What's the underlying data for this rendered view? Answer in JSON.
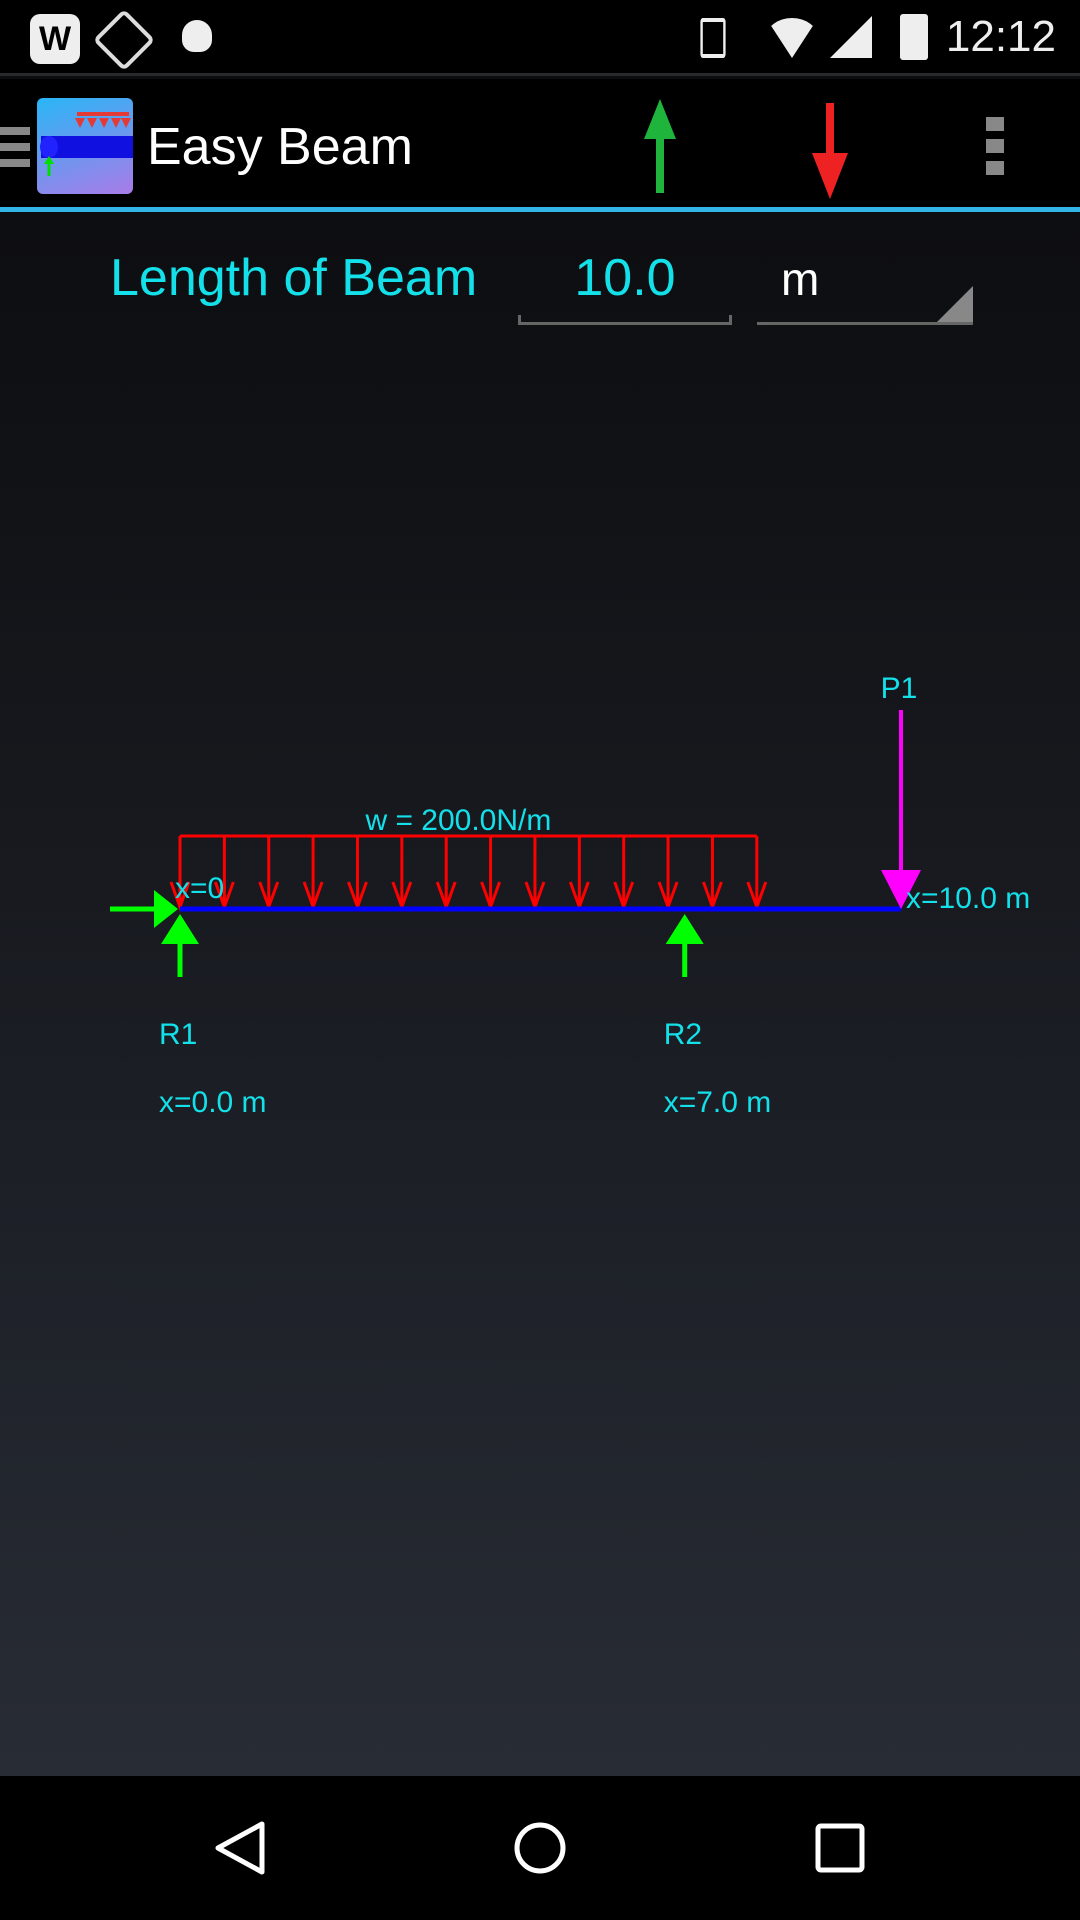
{
  "status_bar": {
    "time": "12:12",
    "left_icons": [
      "wikipedia-icon",
      "maps-navigation-icon",
      "android-debug-icon"
    ],
    "right_icons": [
      "vibrate-icon",
      "wifi-icon",
      "signal-icon",
      "battery-charging-icon"
    ]
  },
  "action_bar": {
    "title": "Easy Beam",
    "actions": [
      "add-upward-force-icon",
      "add-downward-force-icon",
      "overflow-menu-icon"
    ]
  },
  "length": {
    "label": "Length of Beam",
    "value": "10.0",
    "unit": "m"
  },
  "diagram": {
    "beam_length": 10.0,
    "colors": {
      "beam": "#0000ff",
      "distributed_load": "#ff0000",
      "point_load": "#ff00ff",
      "support": "#00ff00",
      "text": "#14e0ea"
    },
    "origin_label": "x=0",
    "end_label": "x=10.0 m",
    "distributed_load": {
      "label": "w = 200.0N/m",
      "start": 0.0,
      "end": 8.0
    },
    "point_load": {
      "label": "P1",
      "position": 10.0
    },
    "supports": [
      {
        "label": "R1",
        "position": 0.0,
        "position_label": "x=0.0 m",
        "horizontal": true
      },
      {
        "label": "R2",
        "position": 7.0,
        "position_label": "x=7.0 m",
        "horizontal": false
      }
    ]
  },
  "nav_bar": {
    "buttons": [
      "back-icon",
      "home-icon",
      "recents-icon"
    ]
  }
}
